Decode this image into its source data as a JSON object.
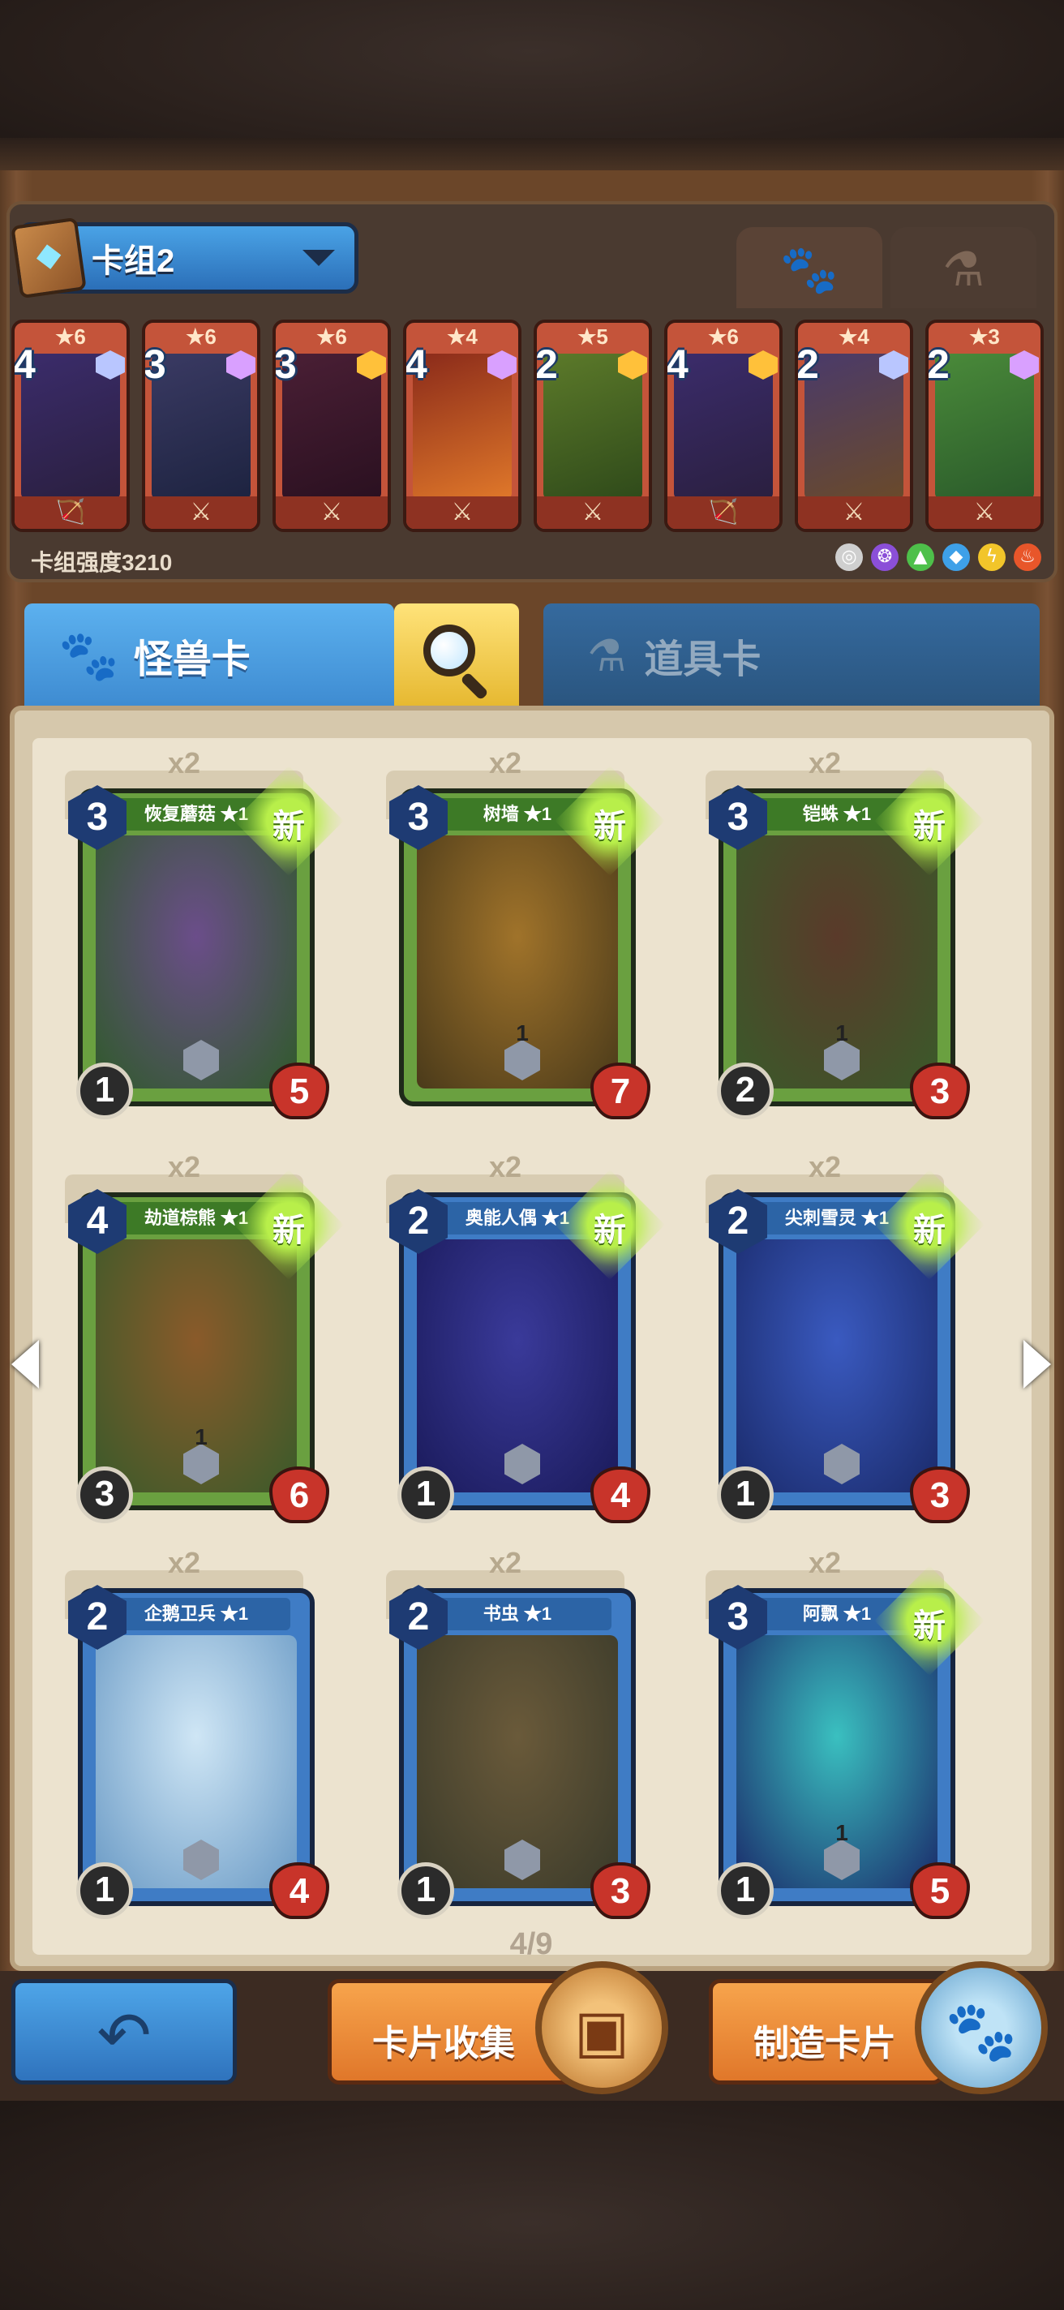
{
  "deck": {
    "name": "卡组2",
    "strength": "卡组强度3210",
    "tabs": [
      {
        "icon": "paw-icon",
        "glyph": "🐾"
      },
      {
        "icon": "potion-icon",
        "glyph": "⚗"
      }
    ],
    "cards": [
      {
        "cost": "4",
        "stars": "★6",
        "colors": [
          "#3b2c6b",
          "#2a1f3f"
        ],
        "gem": "#b9c6ff",
        "weapon": "🏹"
      },
      {
        "cost": "3",
        "stars": "★6",
        "colors": [
          "#3a3a63",
          "#1d2340"
        ],
        "gem": "#d9a0ff",
        "weapon": "⚔"
      },
      {
        "cost": "3",
        "stars": "★6",
        "colors": [
          "#4a1f35",
          "#2a1020"
        ],
        "gem": "#ffc13a",
        "weapon": "⚔"
      },
      {
        "cost": "4",
        "stars": "★4",
        "colors": [
          "#8a2a1a",
          "#e0782a"
        ],
        "gem": "#d9a0ff",
        "weapon": "⚔"
      },
      {
        "cost": "2",
        "stars": "★5",
        "colors": [
          "#5c7a2a",
          "#2f4a1a"
        ],
        "gem": "#ffc13a",
        "weapon": "⚔"
      },
      {
        "cost": "4",
        "stars": "★6",
        "colors": [
          "#3b2c6b",
          "#2a1f3f"
        ],
        "gem": "#ffc13a",
        "weapon": "🏹"
      },
      {
        "cost": "2",
        "stars": "★4",
        "colors": [
          "#4a3a6a",
          "#6a4a2a"
        ],
        "gem": "#b9c6ff",
        "weapon": "⚔"
      },
      {
        "cost": "2",
        "stars": "★3",
        "colors": [
          "#4a8a3a",
          "#2a5a2a"
        ],
        "gem": "#d9a0ff",
        "weapon": "⚔"
      }
    ],
    "elements": [
      {
        "name": "neutral-element-icon",
        "glyph": "◎",
        "color": "#cfcfcf"
      },
      {
        "name": "shadow-element-icon",
        "glyph": "❂",
        "color": "#8b4fd8"
      },
      {
        "name": "nature-element-icon",
        "glyph": "▲",
        "color": "#4ec04a"
      },
      {
        "name": "water-element-icon",
        "glyph": "◆",
        "color": "#3ea0e8"
      },
      {
        "name": "lightning-element-icon",
        "glyph": "ϟ",
        "color": "#f2c52a"
      },
      {
        "name": "fire-element-icon",
        "glyph": "♨",
        "color": "#e8562a"
      }
    ]
  },
  "categories": {
    "monster": {
      "label": "怪兽卡",
      "icon": "paw-icon",
      "glyph": "🐾"
    },
    "item": {
      "label": "道具卡",
      "icon": "potion-icon",
      "glyph": "⚗"
    },
    "search_icon": "search-icon"
  },
  "collection": {
    "page": "4/9",
    "cards": [
      {
        "title": "恢复蘑菇 ★1",
        "count": "x2",
        "cost": "3",
        "atk": "1",
        "hp": "5",
        "mid": "",
        "theme": "green",
        "is_new": true,
        "art": [
          "#6b4d8a",
          "#2f5a2a"
        ]
      },
      {
        "title": "树墙 ★1",
        "count": "x2",
        "cost": "3",
        "atk": "",
        "hp": "7",
        "mid": "1",
        "theme": "green",
        "is_new": true,
        "art": [
          "#a0732a",
          "#4a3a1a"
        ]
      },
      {
        "title": "铠蛛 ★1",
        "count": "x2",
        "cost": "3",
        "atk": "2",
        "hp": "3",
        "mid": "1",
        "theme": "green",
        "is_new": true,
        "art": [
          "#5a3a2a",
          "#3a5a2a"
        ]
      },
      {
        "title": "劫道棕熊 ★1",
        "count": "x2",
        "cost": "4",
        "atk": "3",
        "hp": "6",
        "mid": "1",
        "theme": "green",
        "is_new": true,
        "art": [
          "#8a5a2a",
          "#3a5a2a"
        ]
      },
      {
        "title": "奥能人偶 ★1",
        "count": "x2",
        "cost": "2",
        "atk": "1",
        "hp": "4",
        "mid": "",
        "theme": "blue",
        "is_new": true,
        "art": [
          "#3a3a9a",
          "#1a1a5a"
        ]
      },
      {
        "title": "尖刺雪灵 ★1",
        "count": "x2",
        "cost": "2",
        "atk": "1",
        "hp": "3",
        "mid": "",
        "theme": "blue",
        "is_new": true,
        "art": [
          "#3a5ac0",
          "#1a2a6a"
        ]
      },
      {
        "title": "企鹅卫兵 ★1",
        "count": "x2",
        "cost": "2",
        "atk": "1",
        "hp": "4",
        "mid": "",
        "theme": "blue",
        "is_new": false,
        "art": [
          "#cfe6f5",
          "#6a9ac5"
        ]
      },
      {
        "title": "书虫 ★1",
        "count": "x2",
        "cost": "2",
        "atk": "1",
        "hp": "3",
        "mid": "",
        "theme": "blue",
        "is_new": false,
        "art": [
          "#6a5a3a",
          "#3a3a2a"
        ]
      },
      {
        "title": "阿飘 ★1",
        "count": "x2",
        "cost": "3",
        "atk": "1",
        "hp": "5",
        "mid": "1",
        "theme": "blue",
        "is_new": true,
        "art": [
          "#3ac0c0",
          "#1a2a6a"
        ]
      }
    ],
    "new_label": "新"
  },
  "bottom": {
    "back_icon": "back-arrow-icon",
    "collect_label": "卡片收集",
    "craft_label": "制造卡片"
  }
}
